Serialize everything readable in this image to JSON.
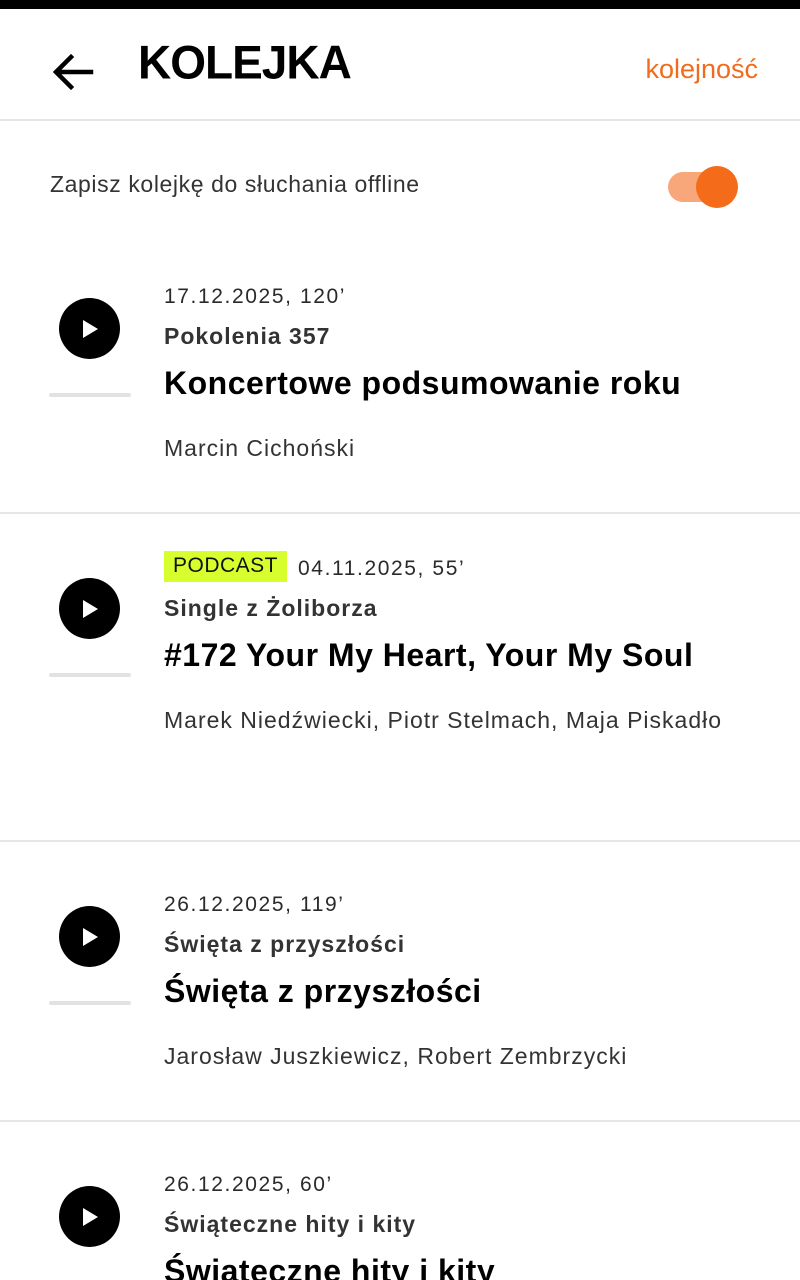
{
  "header": {
    "title": "KOLEJKA",
    "order_link": "kolejność"
  },
  "offline": {
    "label": "Zapisz kolejkę do słuchania offline",
    "enabled": true
  },
  "colors": {
    "accent": "#f26b1d",
    "badge": "#d7ff2e"
  },
  "queue": [
    {
      "badge": "",
      "date": "17.12.2025, 120’",
      "series": "Pokolenia 357",
      "title": "Koncertowe podsumowanie roku",
      "hosts": "Marcin Cichoński"
    },
    {
      "badge": "PODCAST",
      "date": "04.11.2025, 55’",
      "series": "Single z Żoliborza",
      "title": "#172 Your My Heart, Your My Soul",
      "hosts": "Marek Niedźwiecki, Piotr Stelmach, Maja Piskadło"
    },
    {
      "badge": "",
      "date": "26.12.2025, 119’",
      "series": "Święta z przyszłości",
      "title": "Święta z przyszłości",
      "hosts": "Jarosław Juszkiewicz, Robert Zembrzycki"
    },
    {
      "badge": "",
      "date": "26.12.2025, 60’",
      "series": "Świąteczne hity i kity",
      "title": "Świąteczne hity i kity",
      "hosts": ""
    }
  ]
}
